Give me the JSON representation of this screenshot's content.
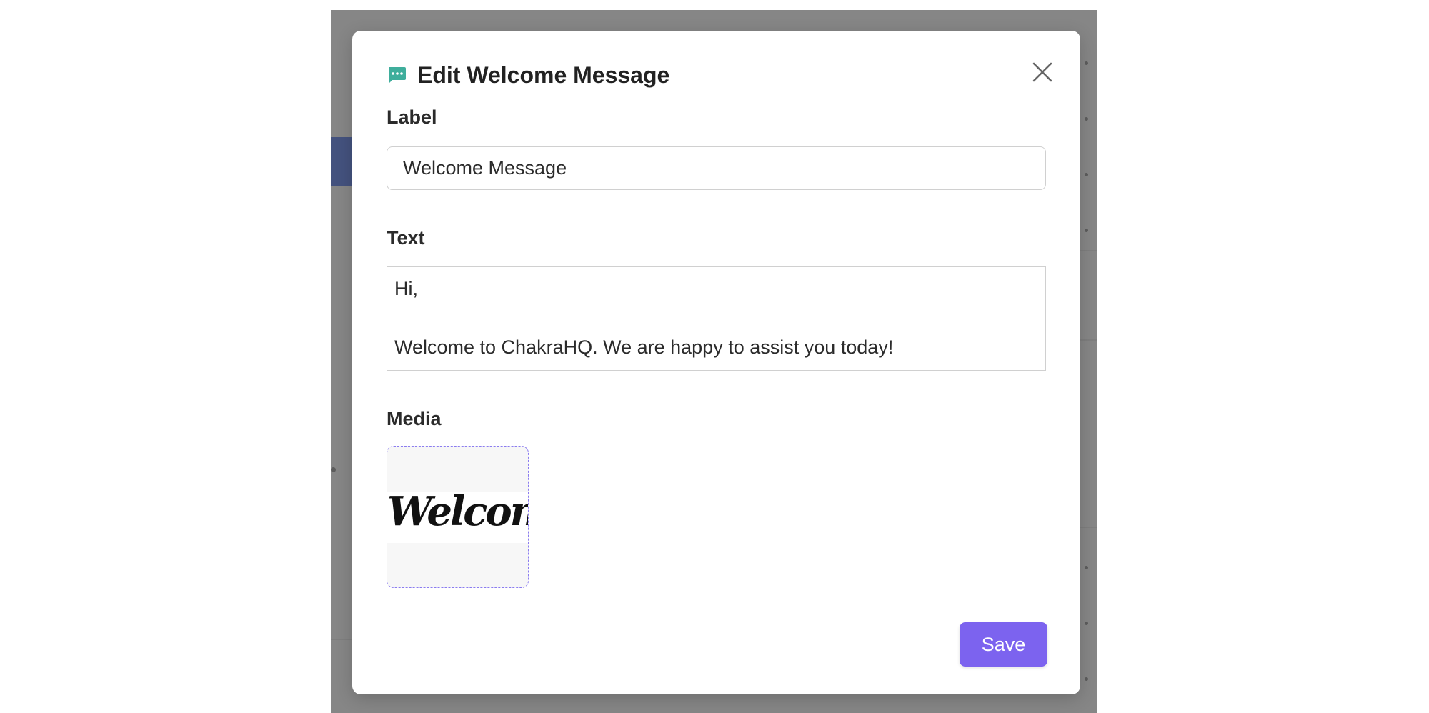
{
  "modal": {
    "title": "Edit Welcome Message",
    "header_icon": "chat-bubble-icon",
    "close_icon": "close-icon",
    "label_field": {
      "label": "Label",
      "value": "Welcome Message"
    },
    "text_field": {
      "label": "Text",
      "lines": [
        "Hi,",
        "",
        "Welcome to ChakraHQ. We are happy to assist you today!"
      ]
    },
    "media": {
      "label": "Media",
      "image_text": "Welcome"
    },
    "save_label": "Save"
  },
  "colors": {
    "accent": "#7c63ef",
    "icon_teal": "#3fae9c",
    "overlay": "#868686"
  }
}
